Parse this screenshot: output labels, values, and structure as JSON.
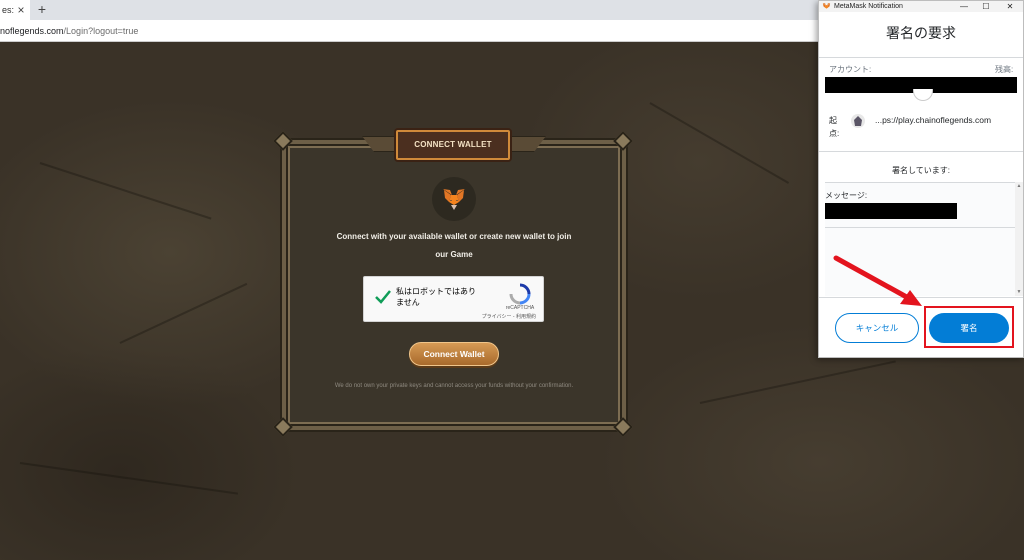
{
  "browser": {
    "tab_title": "es:",
    "tab_close": "×",
    "new_tab": "+",
    "url_main": "noflegends.com",
    "url_rest": "/Login?logout=true"
  },
  "game": {
    "banner_title": "CONNECT WALLET",
    "connect_message_line1": "Connect with your available wallet or create new wallet to join",
    "connect_message_line2": "our Game",
    "captcha": {
      "label": "私はロボットではありません",
      "brand": "reCAPTCHA",
      "links": "プライバシー - 利用規約"
    },
    "connect_button": "Connect Wallet",
    "disclaimer": "We do not own your private keys and cannot access your funds without your confirmation."
  },
  "metamask": {
    "window_title": "MetaMask Notification",
    "controls": {
      "minimize": "—",
      "maximize": "☐",
      "close": "✕"
    },
    "heading": "署名の要求",
    "account_label": "アカウント:",
    "balance_label": "残高:",
    "origin_label": "起点:",
    "origin_url": "...ps://play.chainoflegends.com",
    "signing_label": "署名しています:",
    "message_label": "メッセージ:",
    "cancel_button": "キャンセル",
    "sign_button": "署名",
    "colors": {
      "primary": "#037dd6",
      "highlight": "#e3141e"
    }
  }
}
